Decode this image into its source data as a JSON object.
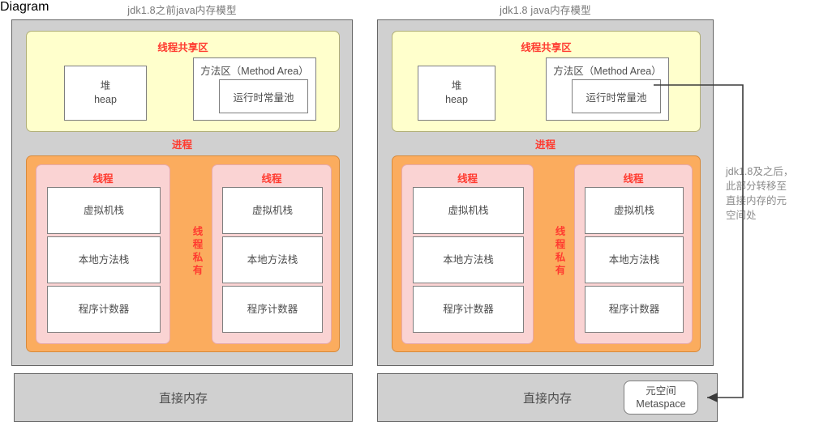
{
  "panels": [
    {
      "id": "pre18",
      "title": "jdk1.8之前java内存模型",
      "shared_label": "线程共享区",
      "process_label": "进程",
      "heap": {
        "line1": "堆",
        "line2": "heap"
      },
      "method_area": {
        "title": "方法区（Method Area）",
        "const_pool": "运行时常量池"
      },
      "private_label": "线程私有",
      "threads": [
        {
          "title": "线程",
          "regions": [
            "虚拟机栈",
            "本地方法栈",
            "程序计数器"
          ]
        },
        {
          "title": "线程",
          "regions": [
            "虚拟机栈",
            "本地方法栈",
            "程序计数器"
          ]
        }
      ],
      "direct_memory": "直接内存",
      "metaspace": null
    },
    {
      "id": "jdk18",
      "title": "jdk1.8 java内存模型",
      "shared_label": "线程共享区",
      "process_label": "进程",
      "heap": {
        "line1": "堆",
        "line2": "heap"
      },
      "method_area": {
        "title": "方法区（Method Area）",
        "const_pool": "运行时常量池"
      },
      "private_label": "线程私有",
      "threads": [
        {
          "title": "线程",
          "regions": [
            "虚拟机栈",
            "本地方法栈",
            "程序计数器"
          ]
        },
        {
          "title": "线程",
          "regions": [
            "虚拟机栈",
            "本地方法栈",
            "程序计数器"
          ]
        }
      ],
      "direct_memory": "直接内存",
      "metaspace": {
        "line1": "元空间",
        "line2": "Metaspace"
      }
    }
  ],
  "annotation": "jdk1.8及之后，此部分转移至直接内存的元空间处",
  "colors": {
    "shared_bg": "#ffffcc",
    "shared_border": "#b0ae78",
    "private_bg": "#fbac5e",
    "thread_bg": "#fad3d3",
    "panel_bg": "#d0d0d0",
    "panel_border": "#666666",
    "red_label": "#ff3b30",
    "text_grey": "#4d4d4d",
    "annotation_grey": "#8c8c8c",
    "connector": "#3a3a3a"
  }
}
